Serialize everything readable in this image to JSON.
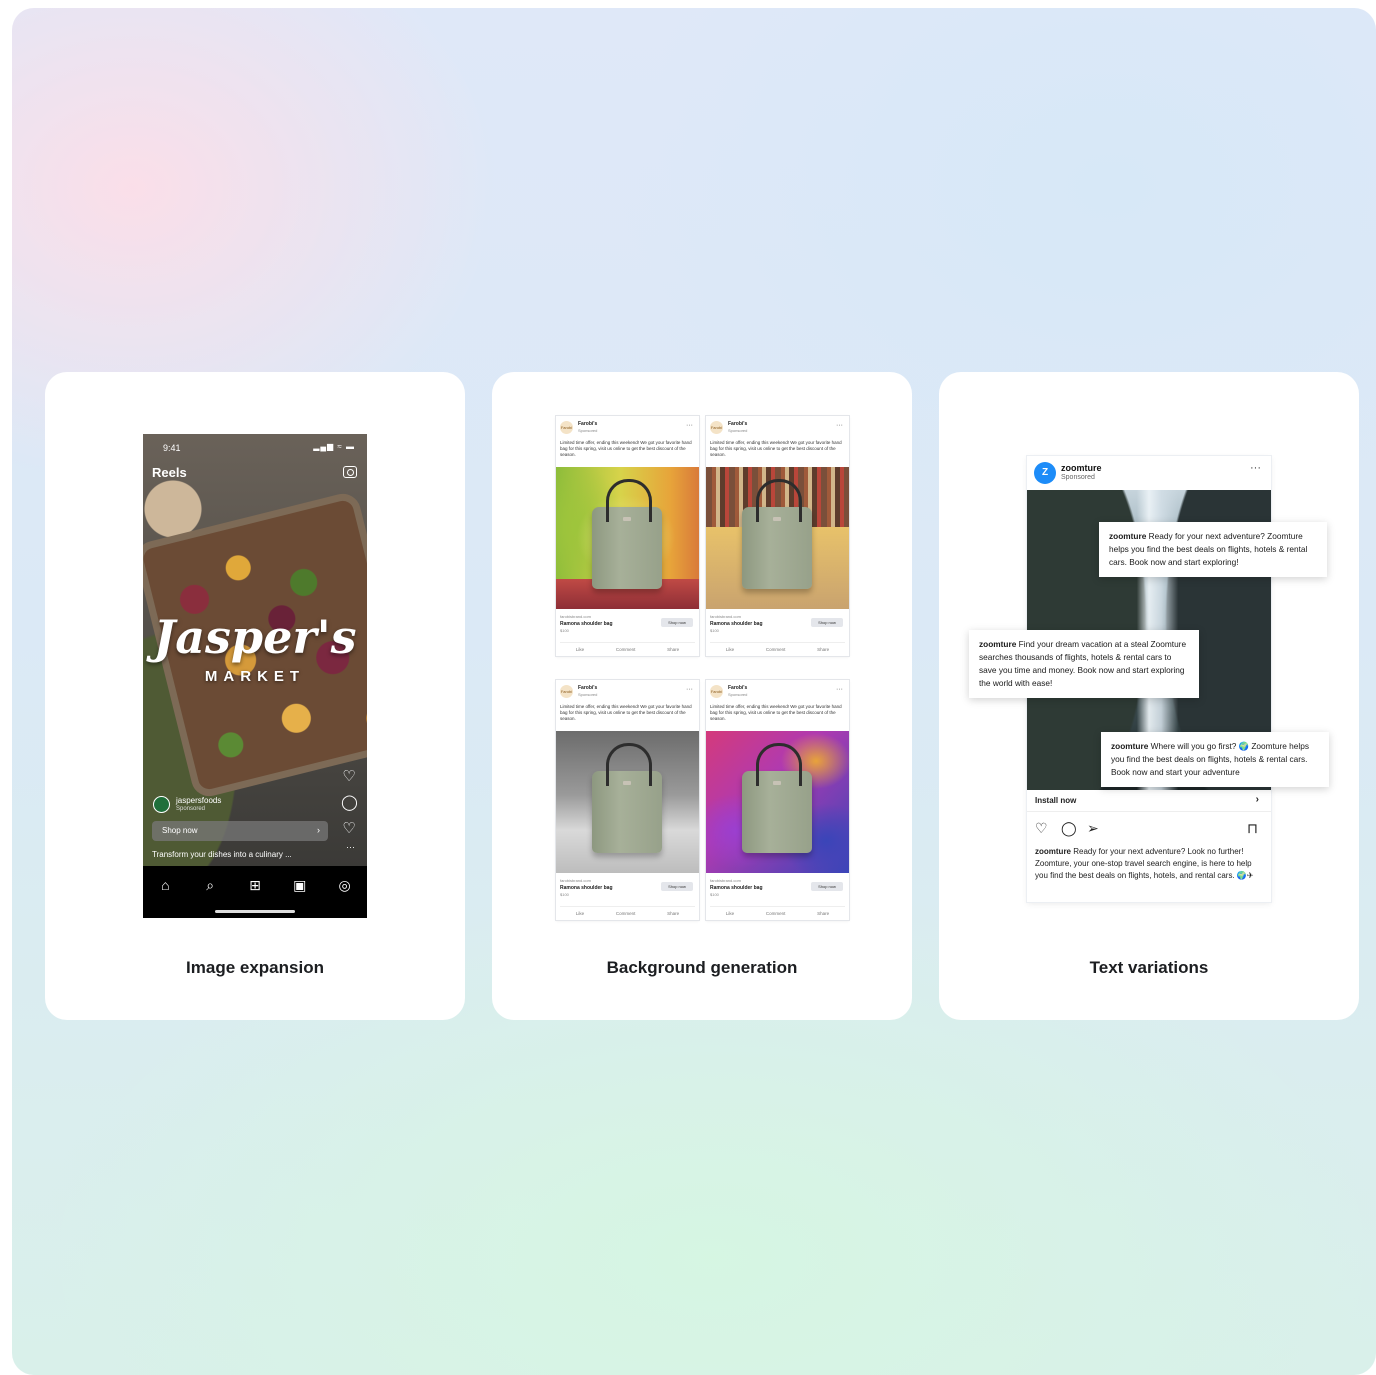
{
  "cards": [
    {
      "label": "Image expansion"
    },
    {
      "label": "Background generation"
    },
    {
      "label": "Text variations"
    }
  ],
  "reel": {
    "time": "9:41",
    "status_icons": "▂▄▆ ≈ ▬",
    "title": "Reels",
    "brand": "Jasper's",
    "brand_sub": "MARKET",
    "handle": "jaspersfoods",
    "sponsored": "Sponsored",
    "shop_label": "Shop now",
    "caption": "Transform your dishes into a culinary ...",
    "more": "···",
    "icons": [
      "camera-icon",
      "heart-icon",
      "comment-icon",
      "share-icon",
      "home-icon",
      "search-icon",
      "create-icon",
      "reels-icon",
      "profile-icon"
    ]
  },
  "ads": {
    "name": "Farobi's",
    "sponsored": "Sponsored",
    "logo": "Farobi",
    "copy": "Limited time offer, ending this weekend! We got your favorite hand bag for this spring, visit us online to get the best discount of the season.",
    "domain": "farobisbrand.com",
    "product": "Ramona shoulder bag",
    "price": "$100",
    "cta": "Shop now",
    "actions": [
      "Like",
      "Comment",
      "Share"
    ],
    "backgrounds": [
      {
        "style": "yellow-green-abstract",
        "colors": [
          "#d7d34a",
          "#9ec53c",
          "#e7a43a",
          "#c04a45"
        ]
      },
      {
        "style": "bookshelf-desk",
        "colors": [
          "#7a4f3a",
          "#c9a36f",
          "#e8c26a"
        ]
      },
      {
        "style": "grey-studio",
        "colors": [
          "#6c6c6c",
          "#bdbdbd",
          "#d9d9d9"
        ]
      },
      {
        "style": "colorful-paint",
        "colors": [
          "#d43a7b",
          "#3a45b8",
          "#e8a33a",
          "#9b3fd0"
        ]
      }
    ]
  },
  "ig": {
    "avatar": "Z",
    "name": "zoomture",
    "sponsored": "Sponsored",
    "dots": "···",
    "variations": [
      {
        "brand": "zoomture",
        "text": "Ready for your next adventure? Zoomture helps you find the best deals on flights, hotels & rental cars. Book now and start exploring!"
      },
      {
        "brand": "zoomture",
        "text": "Find your dream vacation at a steal Zoomture searches thousands of flights, hotels & rental cars to save you time and money. Book now and start exploring the world with ease!"
      },
      {
        "brand": "zoomture",
        "text": "Where will you go first? 🌍 Zoomture helps you find the best deals on flights, hotels & rental cars. Book now and start your adventure"
      }
    ],
    "install": "Install now",
    "caption_brand": "zoomture",
    "caption": "Ready for your next adventure? Look no further! Zoomture, your one-stop travel search engine, is here to help you find the best deals on flights, hotels, and rental cars. 🌍✈"
  }
}
